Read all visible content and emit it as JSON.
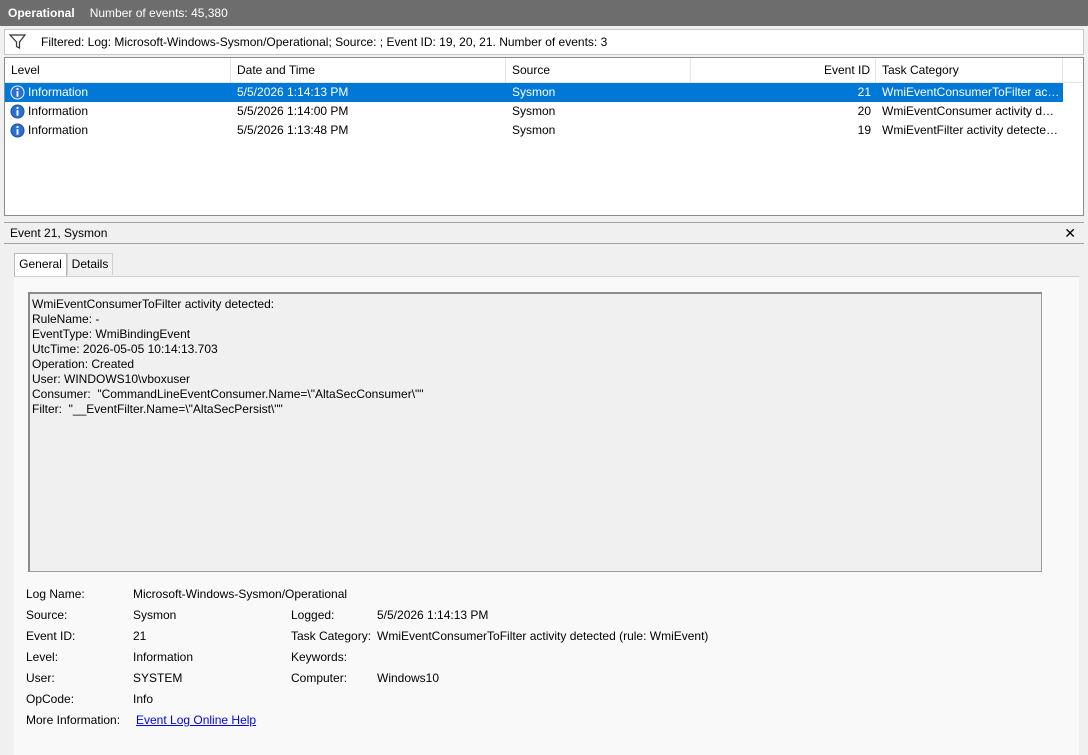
{
  "header": {
    "log_name": "Operational",
    "event_count": "Number of events: 45,380"
  },
  "filter": {
    "text": "Filtered: Log: Microsoft-Windows-Sysmon/Operational; Source: ; Event ID: 19, 20, 21. Number of events: 3"
  },
  "grid": {
    "columns": [
      "Level",
      "Date and Time",
      "Source",
      "Event ID",
      "Task Category"
    ],
    "rows": [
      {
        "level": "Information",
        "datetime": "5/5/2026 1:14:13 PM",
        "source": "Sysmon",
        "event_id": "21",
        "task_category": "WmiEventConsumerToFilter activity detected (rule: WmiEvent)"
      },
      {
        "level": "Information",
        "datetime": "5/5/2026 1:14:00 PM",
        "source": "Sysmon",
        "event_id": "20",
        "task_category": "WmiEventConsumer activity detected (rule: WmiEvent)"
      },
      {
        "level": "Information",
        "datetime": "5/5/2026 1:13:48 PM",
        "source": "Sysmon",
        "event_id": "19",
        "task_category": "WmiEventFilter activity detected (rule: WmiEvent)"
      }
    ],
    "selected_index": 0
  },
  "detail": {
    "title": "Event 21, Sysmon",
    "close_glyph": "✕",
    "tabs": [
      "General",
      "Details"
    ],
    "active_tab": 0,
    "description_lines": [
      "WmiEventConsumerToFilter activity detected:",
      "RuleName: -",
      "EventType: WmiBindingEvent",
      "UtcTime: 2026-05-05 10:14:13.703",
      "Operation: Created",
      "User: WINDOWS10\\vboxuser",
      "Consumer:  \"CommandLineEventConsumer.Name=\\\"AltaSecConsumer\\\"\"",
      "Filter:  \"__EventFilter.Name=\\\"AltaSecPersist\\\"\""
    ],
    "fields": {
      "log_name_label": "Log Name:",
      "log_name": "Microsoft-Windows-Sysmon/Operational",
      "source_label": "Source:",
      "source": "Sysmon",
      "logged_label": "Logged:",
      "logged": "5/5/2026 1:14:13 PM",
      "event_id_label": "Event ID:",
      "event_id": "21",
      "task_category_label": "Task Category:",
      "task_category": "WmiEventConsumerToFilter activity detected (rule: WmiEvent)",
      "level_label": "Level:",
      "level": "Information",
      "keywords_label": "Keywords:",
      "keywords": "",
      "user_label": "User:",
      "user": "SYSTEM",
      "computer_label": "Computer:",
      "computer": "Windows10",
      "opcode_label": "OpCode:",
      "opcode": "Info",
      "more_info_label": "More Information:",
      "more_info_link": "Event Log Online Help"
    }
  },
  "icons": {
    "filter": "filter-icon",
    "information": "information-icon",
    "close": "close-icon"
  },
  "colors": {
    "title_bar": "#6d6d6d",
    "selection": "#0078d7",
    "info_icon": "#2b6fcf",
    "link": "#0000ee"
  }
}
